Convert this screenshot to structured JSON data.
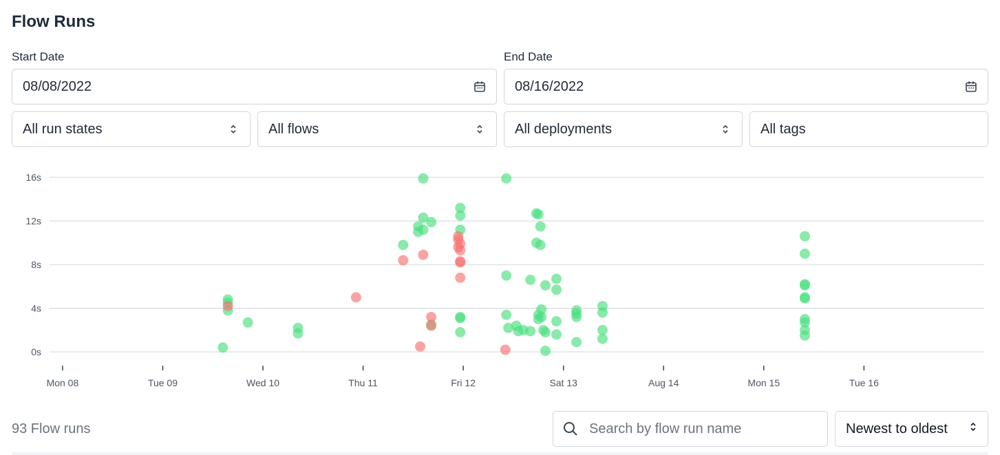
{
  "page": {
    "title": "Flow Runs"
  },
  "filters": {
    "start_date": {
      "label": "Start Date",
      "value": "08/08/2022"
    },
    "end_date": {
      "label": "End Date",
      "value": "08/16/2022"
    },
    "run_states": "All run states",
    "flows": "All flows",
    "deployments": "All deployments",
    "tags": "All tags"
  },
  "icons": {
    "date": "calendar-icon",
    "select": "chevron-up-down-icon",
    "search": "search-icon"
  },
  "colors": {
    "completed": "#4ade80",
    "failed": "#f87171",
    "grid": "#d1d5db",
    "axis_text": "#4b5563"
  },
  "chart_data": {
    "type": "scatter",
    "y_ticks": [
      "0s",
      "4s",
      "8s",
      "12s",
      "16s"
    ],
    "ylim": [
      0,
      16
    ],
    "x_ticks": [
      {
        "day": 0,
        "label": "Mon 08"
      },
      {
        "day": 1,
        "label": "Tue 09"
      },
      {
        "day": 2,
        "label": "Wed 10"
      },
      {
        "day": 3,
        "label": "Thu 11"
      },
      {
        "day": 4,
        "label": "Fri 12"
      },
      {
        "day": 5,
        "label": "Sat 13"
      },
      {
        "day": 6,
        "label": "Aug 14"
      },
      {
        "day": 7,
        "label": "Mon 15"
      },
      {
        "day": 8,
        "label": "Tue 16"
      }
    ],
    "xlim": [
      -0.13,
      9.2
    ],
    "series": [
      {
        "state": "completed",
        "points": [
          [
            1.6,
            0.4
          ],
          [
            1.65,
            4.8
          ],
          [
            1.65,
            4.5
          ],
          [
            1.65,
            3.8
          ],
          [
            1.85,
            2.7
          ],
          [
            2.35,
            2.2
          ],
          [
            2.35,
            1.7
          ],
          [
            3.4,
            9.8
          ],
          [
            3.6,
            15.9
          ],
          [
            3.55,
            11.0
          ],
          [
            3.55,
            11.5
          ],
          [
            3.6,
            12.3
          ],
          [
            3.6,
            11.2
          ],
          [
            3.68,
            11.9
          ],
          [
            3.68,
            2.5
          ],
          [
            3.97,
            13.2
          ],
          [
            3.97,
            12.5
          ],
          [
            3.97,
            11.2
          ],
          [
            3.97,
            3.2
          ],
          [
            3.97,
            3.1
          ],
          [
            3.97,
            1.8
          ],
          [
            4.43,
            15.9
          ],
          [
            4.43,
            7.0
          ],
          [
            4.43,
            3.4
          ],
          [
            4.45,
            2.2
          ],
          [
            4.53,
            2.4
          ],
          [
            4.55,
            1.9
          ],
          [
            4.6,
            2.0
          ],
          [
            4.67,
            1.9
          ],
          [
            4.67,
            6.6
          ],
          [
            4.73,
            12.7
          ],
          [
            4.75,
            12.6
          ],
          [
            4.77,
            11.5
          ],
          [
            4.73,
            10.0
          ],
          [
            4.77,
            9.8
          ],
          [
            4.75,
            3.0
          ],
          [
            4.75,
            3.4
          ],
          [
            4.78,
            3.9
          ],
          [
            4.78,
            3.2
          ],
          [
            4.8,
            2.0
          ],
          [
            4.82,
            1.8
          ],
          [
            4.82,
            6.1
          ],
          [
            4.82,
            0.1
          ],
          [
            4.93,
            6.7
          ],
          [
            4.93,
            5.7
          ],
          [
            4.93,
            2.8
          ],
          [
            4.93,
            1.6
          ],
          [
            5.13,
            3.8
          ],
          [
            5.13,
            3.5
          ],
          [
            5.13,
            3.2
          ],
          [
            5.13,
            0.9
          ],
          [
            5.39,
            4.2
          ],
          [
            5.39,
            3.6
          ],
          [
            5.39,
            2.0
          ],
          [
            5.39,
            1.2
          ],
          [
            7.41,
            10.6
          ],
          [
            7.41,
            9.0
          ],
          [
            7.41,
            6.1
          ],
          [
            7.41,
            6.2
          ],
          [
            7.41,
            5.0
          ],
          [
            7.41,
            4.9
          ],
          [
            7.41,
            3.0
          ],
          [
            7.41,
            2.7
          ],
          [
            7.41,
            2.0
          ],
          [
            7.41,
            1.5
          ]
        ]
      },
      {
        "state": "failed",
        "points": [
          [
            1.65,
            4.2
          ],
          [
            2.93,
            5.0
          ],
          [
            3.4,
            8.4
          ],
          [
            3.57,
            0.5
          ],
          [
            3.6,
            8.9
          ],
          [
            3.68,
            3.2
          ],
          [
            3.68,
            2.4
          ],
          [
            3.95,
            10.6
          ],
          [
            3.95,
            10.3
          ],
          [
            3.97,
            9.9
          ],
          [
            3.95,
            9.6
          ],
          [
            3.97,
            9.3
          ],
          [
            3.97,
            8.3
          ],
          [
            3.97,
            8.2
          ],
          [
            3.97,
            6.8
          ],
          [
            4.42,
            0.2
          ]
        ]
      }
    ]
  },
  "results": {
    "count_label": "93 Flow runs"
  },
  "search": {
    "placeholder": "Search by flow run name"
  },
  "sort": {
    "value": "Newest to oldest"
  }
}
